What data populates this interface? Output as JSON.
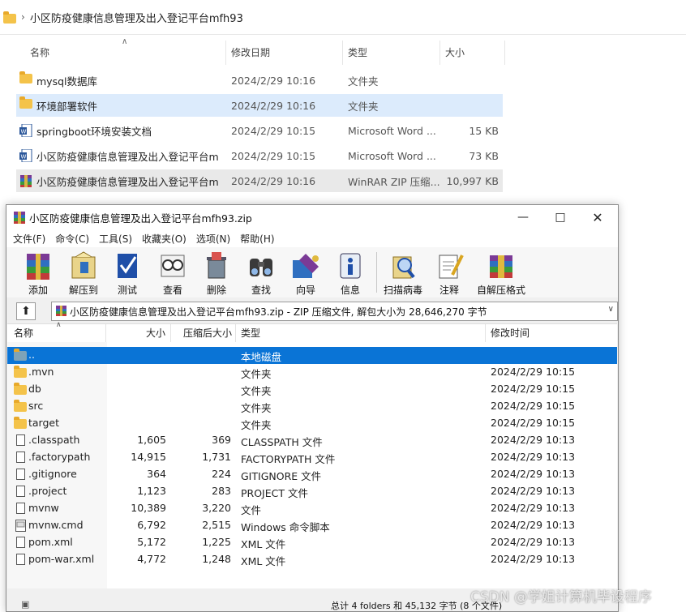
{
  "explorer": {
    "breadcrumb": "小区防疫健康信息管理及出入登记平台mfh93",
    "columns": {
      "name": "名称",
      "date": "修改日期",
      "type": "类型",
      "size": "大小"
    },
    "rows": [
      {
        "name": "mysql数据库",
        "date": "2024/2/29 10:16",
        "type": "文件夹",
        "size": "",
        "icon": "folder-icon"
      },
      {
        "name": "环境部署软件",
        "date": "2024/2/29 10:16",
        "type": "文件夹",
        "size": "",
        "icon": "folder-icon"
      },
      {
        "name": "springboot环境安装文档",
        "date": "2024/2/29 10:15",
        "type": "Microsoft Word ...",
        "size": "15 KB",
        "icon": "word-doc-icon"
      },
      {
        "name": "小区防疫健康信息管理及出入登记平台m...",
        "date": "2024/2/29 10:15",
        "type": "Microsoft Word ...",
        "size": "73 KB",
        "icon": "word-doc-icon"
      },
      {
        "name": "小区防疫健康信息管理及出入登记平台m...",
        "date": "2024/2/29 10:16",
        "type": "WinRAR ZIP 压缩...",
        "size": "10,997 KB",
        "icon": "winrar-archive-icon"
      }
    ]
  },
  "winrar": {
    "title": "小区防疫健康信息管理及出入登记平台mfh93.zip",
    "menu": [
      "文件(F)",
      "命令(C)",
      "工具(S)",
      "收藏夹(O)",
      "选项(N)",
      "帮助(H)"
    ],
    "toolbar": [
      "添加",
      "解压到",
      "测试",
      "查看",
      "删除",
      "查找",
      "向导",
      "信息",
      "扫描病毒",
      "注释",
      "自解压格式"
    ],
    "path": "小区防疫健康信息管理及出入登记平台mfh93.zip - ZIP 压缩文件, 解包大小为 28,646,270 字节",
    "columns": {
      "name": "名称",
      "size": "大小",
      "packed": "压缩后大小",
      "type": "类型",
      "modified": "修改时间"
    },
    "rows": [
      {
        "name": "..",
        "size": "",
        "packed": "",
        "type": "本地磁盘",
        "modified": "",
        "icon": "folder-up-icon"
      },
      {
        "name": ".mvn",
        "size": "",
        "packed": "",
        "type": "文件夹",
        "modified": "2024/2/29 10:15",
        "icon": "folder-icon"
      },
      {
        "name": "db",
        "size": "",
        "packed": "",
        "type": "文件夹",
        "modified": "2024/2/29 10:15",
        "icon": "folder-icon"
      },
      {
        "name": "src",
        "size": "",
        "packed": "",
        "type": "文件夹",
        "modified": "2024/2/29 10:15",
        "icon": "folder-icon"
      },
      {
        "name": "target",
        "size": "",
        "packed": "",
        "type": "文件夹",
        "modified": "2024/2/29 10:15",
        "icon": "folder-icon"
      },
      {
        "name": ".classpath",
        "size": "1,605",
        "packed": "369",
        "type": "CLASSPATH 文件",
        "modified": "2024/2/29 10:13",
        "icon": "file-icon"
      },
      {
        "name": ".factorypath",
        "size": "14,915",
        "packed": "1,731",
        "type": "FACTORYPATH 文件",
        "modified": "2024/2/29 10:13",
        "icon": "file-icon"
      },
      {
        "name": ".gitignore",
        "size": "364",
        "packed": "224",
        "type": "GITIGNORE 文件",
        "modified": "2024/2/29 10:13",
        "icon": "file-icon"
      },
      {
        "name": ".project",
        "size": "1,123",
        "packed": "283",
        "type": "PROJECT 文件",
        "modified": "2024/2/29 10:13",
        "icon": "file-icon"
      },
      {
        "name": "mvnw",
        "size": "10,389",
        "packed": "3,220",
        "type": "文件",
        "modified": "2024/2/29 10:13",
        "icon": "file-icon"
      },
      {
        "name": "mvnw.cmd",
        "size": "6,792",
        "packed": "2,515",
        "type": "Windows 命令脚本",
        "modified": "2024/2/29 10:13",
        "icon": "cmd-file-icon"
      },
      {
        "name": "pom.xml",
        "size": "5,172",
        "packed": "1,225",
        "type": "XML 文件",
        "modified": "2024/2/29 10:13",
        "icon": "file-icon"
      },
      {
        "name": "pom-war.xml",
        "size": "4,772",
        "packed": "1,248",
        "type": "XML 文件",
        "modified": "2024/2/29 10:13",
        "icon": "file-icon"
      }
    ],
    "status": "总计 4 folders 和 45,132 字节 (8 个文件)"
  },
  "watermark": "CSDN @学姐计算机毕设程序"
}
